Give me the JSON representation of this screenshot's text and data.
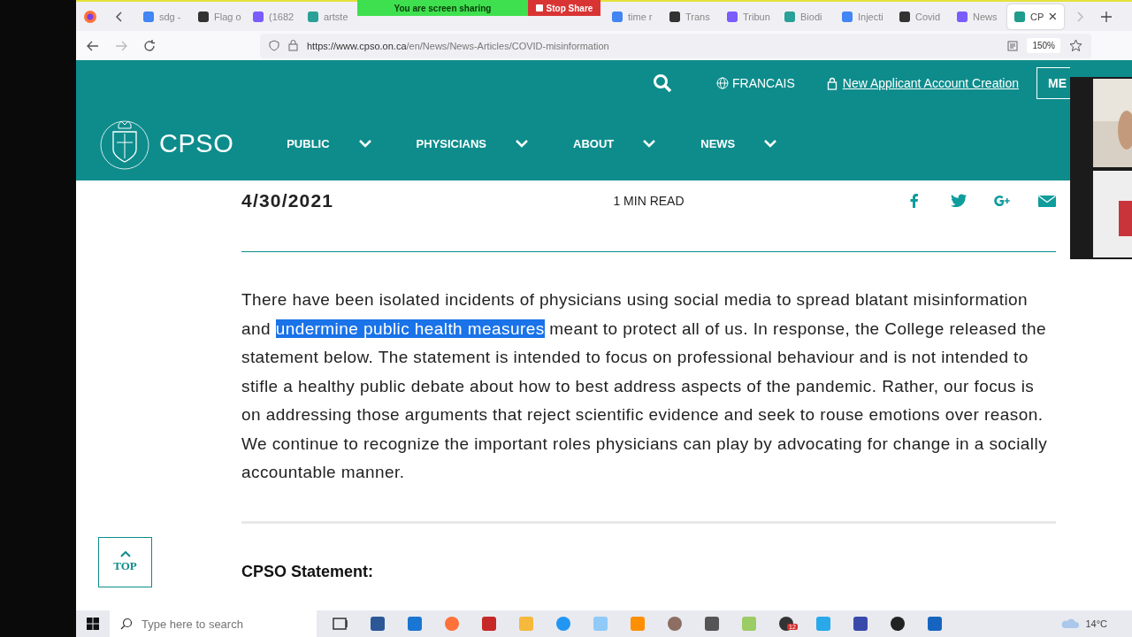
{
  "sharing_banner": {
    "text": "You are screen sharing",
    "stop_button": "Stop Share"
  },
  "tabs": [
    {
      "title": "sdg -",
      "selected": false
    },
    {
      "title": "Flag o",
      "selected": false
    },
    {
      "title": "(1682",
      "selected": false
    },
    {
      "title": "artste",
      "selected": false
    },
    {
      "title": "time r",
      "selected": false
    },
    {
      "title": "Trans",
      "selected": false
    },
    {
      "title": "Tribun",
      "selected": false
    },
    {
      "title": "Biodi",
      "selected": false
    },
    {
      "title": "Injecti",
      "selected": false
    },
    {
      "title": "Covid",
      "selected": false
    },
    {
      "title": "News",
      "selected": false
    },
    {
      "title": "CP",
      "selected": true
    }
  ],
  "address_bar": {
    "url_host": "https://www.cpso.on.ca",
    "url_path": "/en/News/News-Articles/COVID-misinformation",
    "zoom": "150%"
  },
  "site_header": {
    "language": "FRANCAIS",
    "account_link": "New Applicant Account Creation",
    "menu_button": "ME",
    "logo": "CPSO",
    "nav": [
      "PUBLIC",
      "PHYSICIANS",
      "ABOUT",
      "NEWS"
    ]
  },
  "article": {
    "date": "4/30/2021",
    "read_time": "1 MIN READ",
    "paragraph": {
      "before": "There have been isolated incidents of physicians using social media to spread blatant misinformation and ",
      "highlighted": "undermine public health measures",
      "after": " meant to protect all of us. In response, the College released the statement below. The statement is intended to focus on professional behaviour and is not intended to stifle a healthy public debate about how to best address aspects of the pandemic. Rather, our focus is on addressing those arguments that reject scientific evidence and seek to rouse emotions over reason. We continue to recognize the important roles physicians can play by advocating for change in a socially accountable manner."
    },
    "heading": "CPSO Statement:",
    "top_button": "TOP"
  },
  "taskbar": {
    "search_placeholder": "Type here to search",
    "temperature": "14°C",
    "badge": "12"
  }
}
